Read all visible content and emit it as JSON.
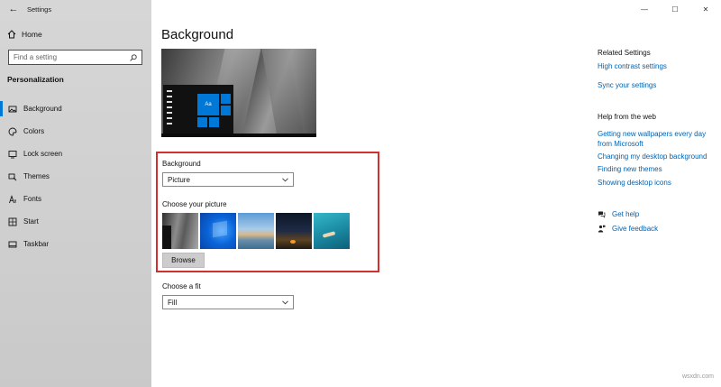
{
  "window": {
    "app_title": "Settings",
    "controls": {
      "minimize": "—",
      "maximize": "☐",
      "close": "✕"
    }
  },
  "sidebar": {
    "home_label": "Home",
    "search_placeholder": "Find a setting",
    "section_title": "Personalization",
    "items": [
      {
        "label": "Background",
        "icon": "image-icon",
        "active": true
      },
      {
        "label": "Colors",
        "icon": "palette-icon",
        "active": false
      },
      {
        "label": "Lock screen",
        "icon": "lock-screen-icon",
        "active": false
      },
      {
        "label": "Themes",
        "icon": "brush-icon",
        "active": false
      },
      {
        "label": "Fonts",
        "icon": "font-icon",
        "active": false
      },
      {
        "label": "Start",
        "icon": "start-grid-icon",
        "active": false
      },
      {
        "label": "Taskbar",
        "icon": "taskbar-icon",
        "active": false
      }
    ]
  },
  "main": {
    "title": "Background",
    "preview_tile_label": "Aa",
    "background_label": "Background",
    "background_value": "Picture",
    "choose_picture_label": "Choose your picture",
    "browse_label": "Browse",
    "fit_label": "Choose a fit",
    "fit_value": "Fill"
  },
  "right": {
    "related_title": "Related Settings",
    "related_links": [
      "High contrast settings",
      "Sync your settings"
    ],
    "help_title": "Help from the web",
    "help_links": [
      "Getting new wallpapers every day from Microsoft",
      "Changing my desktop background",
      "Finding new themes",
      "Showing desktop icons"
    ],
    "get_help": "Get help",
    "give_feedback": "Give feedback"
  },
  "watermark": "wsxdn.com",
  "colors": {
    "accent": "#0078d7",
    "link": "#0063b1",
    "highlight_box": "#d32f2f"
  }
}
